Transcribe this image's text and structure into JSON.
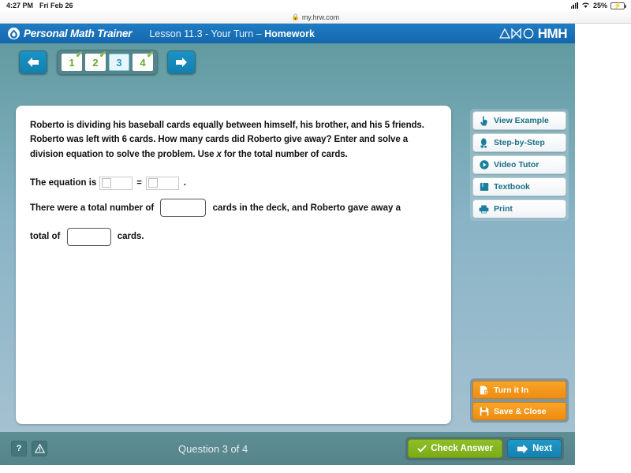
{
  "status_bar": {
    "time": "4:27 PM",
    "date": "Fri Feb 26",
    "battery_percent": "25%",
    "signal_icon": "cellular-signal-icon",
    "wifi_icon": "wifi-icon",
    "battery_icon": "battery-charging-icon"
  },
  "browser": {
    "url": "my.hrw.com",
    "lock_icon": "lock-icon"
  },
  "header": {
    "app_name": "Personal Math Trainer",
    "lesson_prefix": "Lesson 11.3 - Your Turn – ",
    "lesson_suffix": "Homework",
    "brand": "HMH",
    "logo_icon": "pmt-flame-logo-icon",
    "brand_icon": "hmh-shapes-icon"
  },
  "nav": {
    "prev_icon": "arrow-left-icon",
    "next_icon": "arrow-right-icon",
    "questions": [
      {
        "label": "1",
        "completed": true,
        "current": false
      },
      {
        "label": "2",
        "completed": true,
        "current": false
      },
      {
        "label": "3",
        "completed": false,
        "current": true
      },
      {
        "label": "4",
        "completed": true,
        "current": false
      }
    ],
    "check_glyph": "✔"
  },
  "problem": {
    "text_part1": "Roberto is dividing his baseball cards equally between himself, his brother, and his 5 friends. Roberto was left with 6 cards. How many cards did Roberto give away? Enter and solve a division equation to solve the problem. Use ",
    "variable": "x",
    "text_part2": " for the total number of cards."
  },
  "answers": {
    "equation_label": "The equation is",
    "equals_sign": "=",
    "period": ".",
    "field_left_value": "",
    "field_right_value": "",
    "sentence1_part1": "There were a total number of",
    "sentence1_part2": "cards in the deck, and Roberto gave away a",
    "sentence2_part1": "total of",
    "sentence2_part2": "cards.",
    "total_cards_value": "",
    "given_away_value": ""
  },
  "toolbar": {
    "items": [
      {
        "label": "View Example",
        "icon": "pointing-hand-icon"
      },
      {
        "label": "Step-by-Step",
        "icon": "footprint-icon"
      },
      {
        "label": "Video Tutor",
        "icon": "play-circle-icon"
      },
      {
        "label": "Textbook",
        "icon": "book-icon"
      },
      {
        "label": "Print",
        "icon": "printer-icon"
      }
    ]
  },
  "actions": {
    "items": [
      {
        "label": "Turn it In",
        "icon": "document-submit-icon"
      },
      {
        "label": "Save & Close",
        "icon": "floppy-disk-icon"
      }
    ]
  },
  "bottom_bar": {
    "help_label": "?",
    "help_icon": "question-mark-icon",
    "warning_icon": "warning-triangle-icon",
    "counter": "Question 3 of 4",
    "check_answer_label": "Check Answer",
    "check_answer_icon": "checkmark-icon",
    "next_label": "Next",
    "next_icon": "arrow-right-icon"
  },
  "colors": {
    "header_blue": "#1a72b8",
    "teal_bg": "#5d989c",
    "accent_orange": "#f29b1d",
    "check_green": "#85b922",
    "next_blue": "#1a8ec0",
    "tool_text": "#1d6e86"
  }
}
